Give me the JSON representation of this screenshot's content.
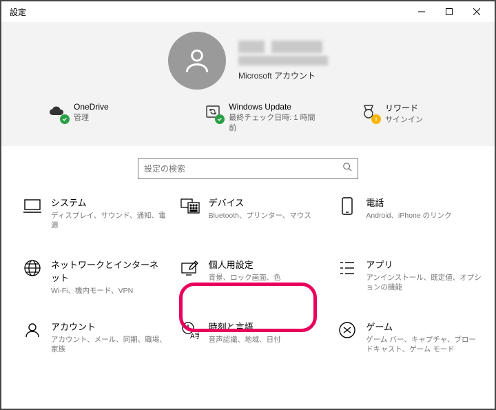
{
  "window_title": "設定",
  "account": {
    "ms_label": "Microsoft アカウント"
  },
  "status": {
    "onedrive": {
      "title": "OneDrive",
      "sub": "管理"
    },
    "update": {
      "title": "Windows Update",
      "sub": "最終チェック日時: 1 時間前"
    },
    "rewards": {
      "title": "リワード",
      "sub": "サインイン"
    }
  },
  "search": {
    "placeholder": "設定の検索"
  },
  "categories": {
    "system": {
      "title": "システム",
      "sub": "ディスプレイ、サウンド、通知、電源"
    },
    "devices": {
      "title": "デバイス",
      "sub": "Bluetooth、プリンター、マウス"
    },
    "phone": {
      "title": "電話",
      "sub": "Android、iPhone のリンク"
    },
    "network": {
      "title": "ネットワークとインターネット",
      "sub": "Wi-Fi、機内モード、VPN"
    },
    "personalize": {
      "title": "個人用設定",
      "sub": "背景、ロック画面、色"
    },
    "apps": {
      "title": "アプリ",
      "sub": "アンインストール、既定値、オプションの機能"
    },
    "accounts": {
      "title": "アカウント",
      "sub": "アカウント、メール、同期、職場、家族"
    },
    "time": {
      "title": "時刻と言語",
      "sub": "音声認識、地域、日付"
    },
    "gaming": {
      "title": "ゲーム",
      "sub": "ゲーム バー、キャプチャ、ブロードキャスト、ゲーム モード"
    }
  }
}
